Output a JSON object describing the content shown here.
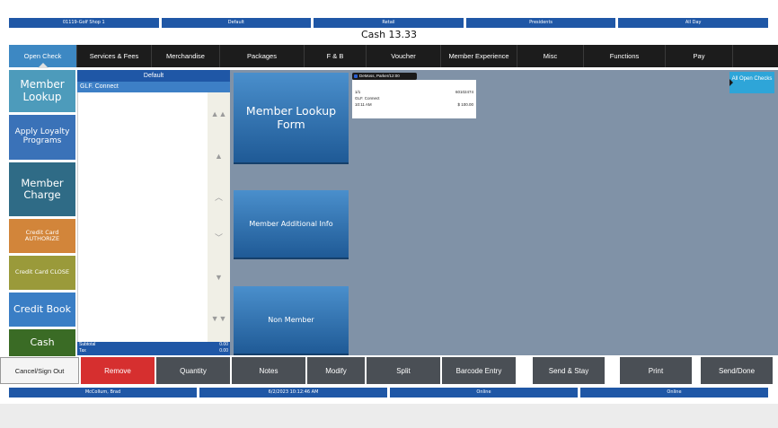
{
  "top_bar": [
    "01119-Golf Shop 1",
    "Default",
    "Retail",
    "Presidents",
    "All Day"
  ],
  "cash_title": "Cash 13.33",
  "tabs": [
    "Open Check",
    "Services & Fees",
    "Merchandise",
    "Packages",
    "F & B",
    "Voucher",
    "Member Experience",
    "Misc",
    "Functions",
    "Pay"
  ],
  "left_buttons": {
    "member_lookup": "Member Lookup",
    "apply_loyalty": "Apply Loyalty Programs",
    "member_charge": "Member Charge",
    "cc_authorize": "Credit Card AUTHORIZE",
    "cc_close": "Credit Card CLOSE",
    "credit_book": "Credit Book",
    "cash": "Cash"
  },
  "panel": {
    "header": "Default",
    "selected_item": "GLF. Connect",
    "subtotal_label": "Subtotal",
    "subtotal_value": "0.00",
    "tax_label": "Tax",
    "tax_value": "0.00"
  },
  "main_buttons": {
    "member_lookup_form": "Member Lookup Form",
    "member_additional_info": "Member Additional Info",
    "non_member": "Non Member"
  },
  "check": {
    "header": "DeMoss, Parker/12:00",
    "seq": "1/1",
    "number": "60102474",
    "location": "GLF. Connect",
    "time": "10:11 AM",
    "amount": "$ 100.00"
  },
  "all_open_checks": "All Open Checks",
  "bottom_buttons": {
    "cancel": "Cancel/Sign Out",
    "remove": "Remove",
    "quantity": "Quantity",
    "notes": "Notes",
    "modify": "Modify",
    "split": "Split",
    "barcode": "Barcode Entry",
    "send_stay": "Send & Stay",
    "print": "Print",
    "send_done": "Send/Done"
  },
  "status_bar": [
    "McCollum, Brad",
    "6/2/2023 10:12:46 AM",
    "Online",
    "Online"
  ],
  "colors": {
    "accent_blue": "#1f57a6",
    "tab_active": "#3d88c3",
    "remove_red": "#d62f2f",
    "cash_green": "#3a6b25"
  }
}
